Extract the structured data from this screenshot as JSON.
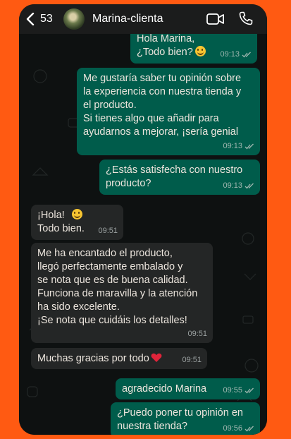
{
  "header": {
    "back_count": "53",
    "contact_name": "Marina-clienta",
    "icons": [
      "back-icon",
      "avatar",
      "video-call-icon",
      "phone-call-icon"
    ]
  },
  "messages": [
    {
      "dir": "out",
      "text": "Hola Marina,\n¿Todo bien?",
      "time": "09:13",
      "emoji": "smile"
    },
    {
      "dir": "out",
      "text": "Me gustaría saber tu opinión sobre\nla experiencia con nuestra tienda y\nel producto.\nSi tienes algo que añadir para\nayudarnos a mejorar, ¡sería genial",
      "time": "09:13"
    },
    {
      "dir": "out",
      "text": "¿Estás satisfecha con nuestro\nproducto?",
      "time": "09:13"
    },
    {
      "dir": "in",
      "text": "¡Hola!\nTodo bien.",
      "time": "09:51",
      "emoji": "smile"
    },
    {
      "dir": "in",
      "text": "Me ha encantado el producto,\nllegó perfectamente embalado y\nse nota que es de buena calidad.\nFunciona de maravilla y la atención\nha sido excelente.\n¡Se nota que cuidáis los detalles!",
      "time": "09:51"
    },
    {
      "dir": "in",
      "text": "Muchas gracias por todo",
      "time": "09:51",
      "emoji": "heart"
    },
    {
      "dir": "out",
      "text": "agradecido Marina",
      "time": "09:55"
    },
    {
      "dir": "out",
      "text": "¿Puedo poner tu opinión en\nnuestra tienda?",
      "time": "09:56"
    }
  ],
  "colors": {
    "background": "#ff5a12",
    "outgoing_bubble": "#005c4b",
    "incoming_bubble": "#242626",
    "read_ticks": "#9fb7b0"
  }
}
